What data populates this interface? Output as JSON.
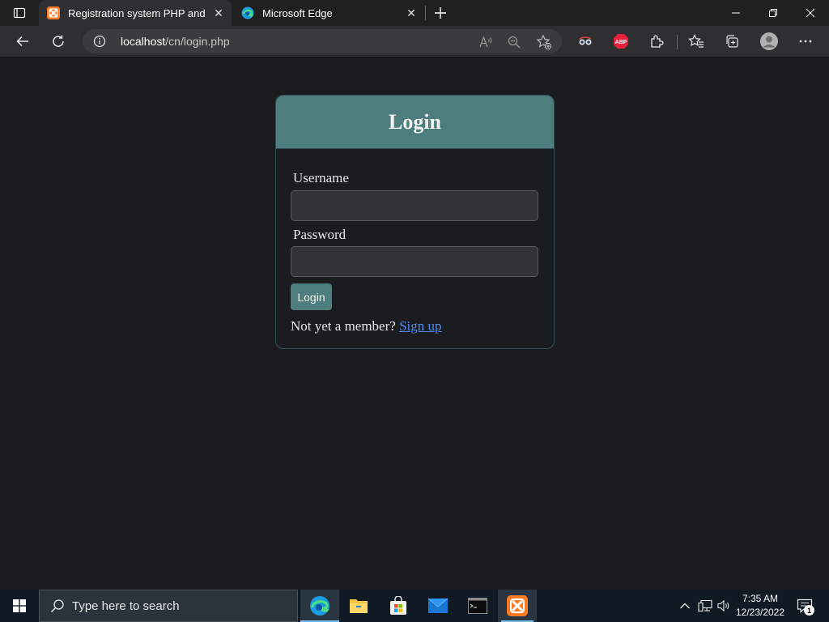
{
  "browser": {
    "tabs": [
      {
        "title": "Registration system PHP and MySQL",
        "active": true,
        "icon": "xampp-icon"
      },
      {
        "title": "Microsoft Edge",
        "active": false,
        "icon": "edge-icon"
      }
    ],
    "address": {
      "host": "localhost",
      "path": "/cn/login.php"
    },
    "extensions": [
      "bookmarklet-icon",
      "abp-icon",
      "extensions-icon"
    ],
    "abp_label": "ABP"
  },
  "page": {
    "card_title": "Login",
    "username_label": "Username",
    "username_value": "",
    "password_label": "Password",
    "password_value": "",
    "login_button": "Login",
    "signup_prompt": "Not yet a member?",
    "signup_link": "Sign up"
  },
  "taskbar": {
    "search_placeholder": "Type here to search",
    "apps": [
      "edge-icon",
      "file-explorer-icon",
      "store-icon",
      "mail-icon",
      "terminal-icon",
      "xampp-icon"
    ],
    "time": "7:35 AM",
    "date": "12/23/2022",
    "notification_count": "1"
  },
  "colors": {
    "accent": "#4e7d7d",
    "link": "#4d8df5",
    "background": "#1c1c1e"
  }
}
